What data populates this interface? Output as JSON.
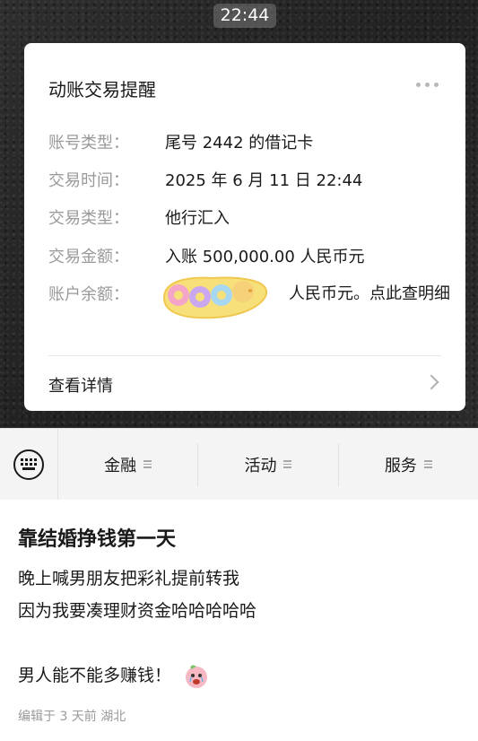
{
  "chat": {
    "time": "22:44"
  },
  "card": {
    "title": "动账交易提醒",
    "rows": [
      {
        "label": "账号类型：",
        "value": "尾号 2442 的借记卡"
      },
      {
        "label": "交易时间：",
        "value": "2025 年 6 月 11 日 22:44"
      },
      {
        "label": "交易类型：",
        "value": "他行汇入"
      },
      {
        "label": "交易金额：",
        "value": "入账 500,000.00 人民币元"
      },
      {
        "label": "账户余额：",
        "value": "人民币元。点此查明细"
      }
    ],
    "details_link": "查看详情",
    "sticker_icon": "good-sticker-icon"
  },
  "menu": {
    "items": [
      {
        "label": "金融"
      },
      {
        "label": "活动"
      },
      {
        "label": "服务"
      }
    ]
  },
  "post": {
    "title": "靠结婚挣钱第一天",
    "lines": [
      "晚上喊男朋友把彩礼提前转我",
      "因为我要凑理财资金哈哈哈哈哈",
      "男人能不能多赚钱！"
    ],
    "meta": "编辑于 3 天前 湖北"
  }
}
